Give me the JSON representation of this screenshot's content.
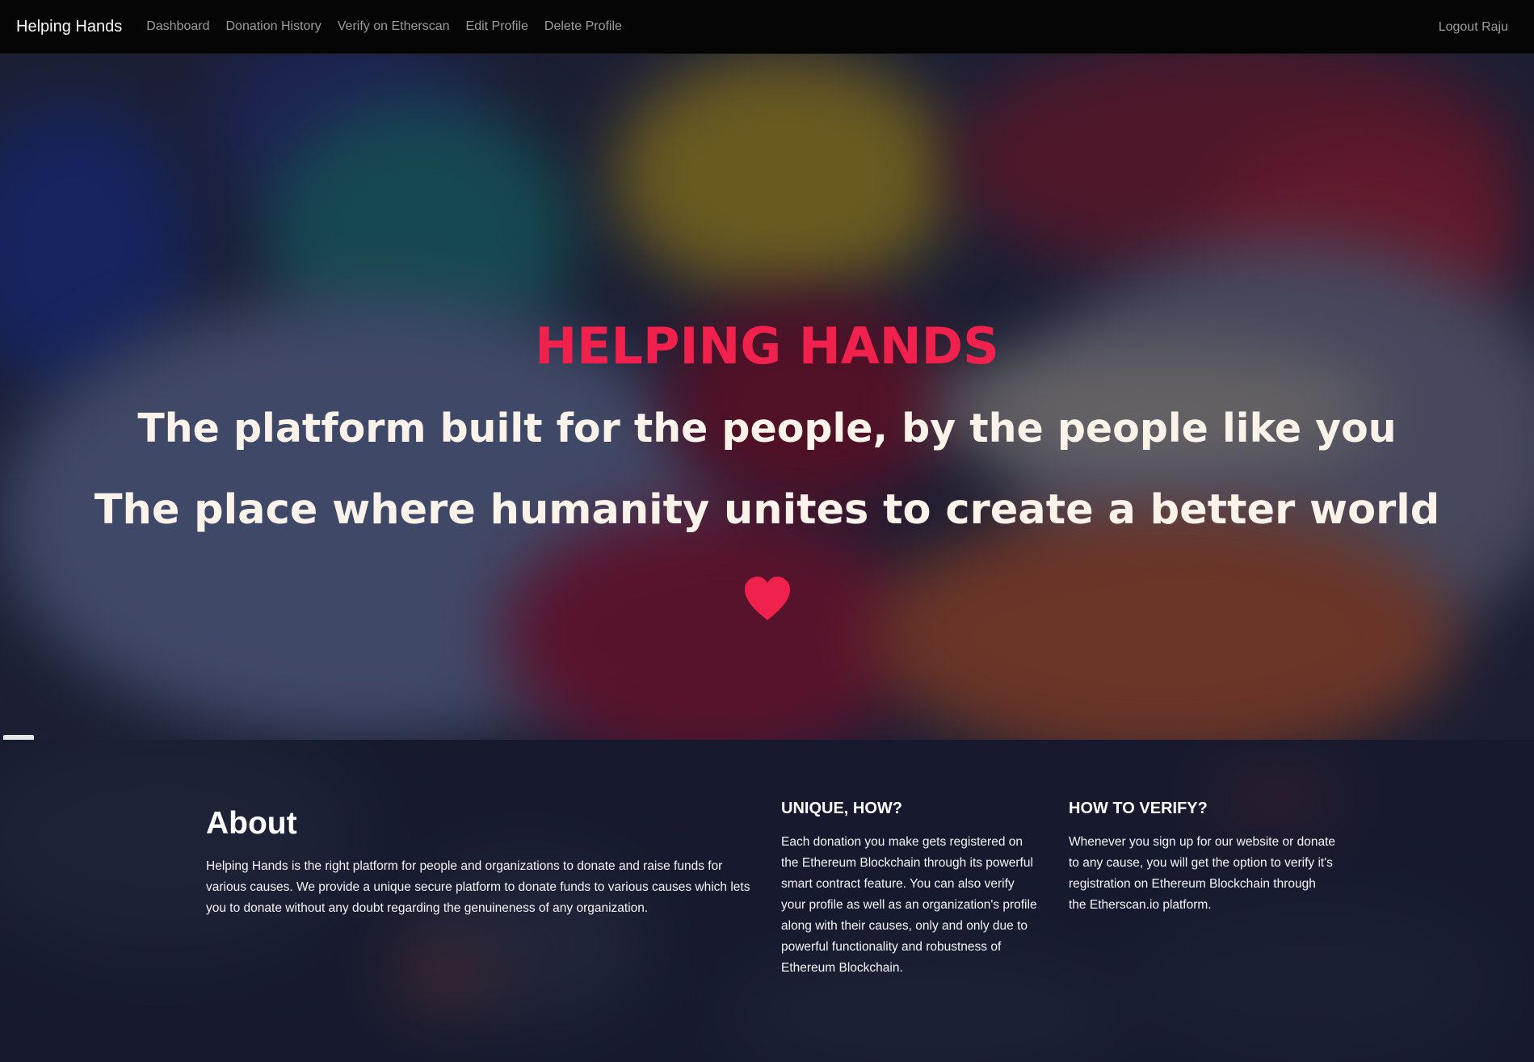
{
  "navbar": {
    "brand": "Helping Hands",
    "links": [
      "Dashboard",
      "Donation History",
      "Verify on Etherscan",
      "Edit Profile",
      "Delete Profile"
    ],
    "logout": "Logout Raju"
  },
  "hero": {
    "title": "HELPING HANDS",
    "line1": "The platform built for the people, by the people like you",
    "line2": "The place where humanity unites to create a better world",
    "icon": "heart-icon",
    "accent_color": "#f0214c"
  },
  "about": {
    "title": "About",
    "text": "Helping Hands is the right platform for people and organizations to donate and raise funds for various causes. We provide a unique secure platform to donate funds to various causes which lets you to donate without any doubt regarding the genuineness of any organization."
  },
  "unique": {
    "heading": "UNIQUE, HOW?",
    "text": "Each donation you make gets registered on the Ethereum Blockchain through its powerful smart contract feature. You can also verify your profile as well as an organization's profile along with their causes, only and only due to powerful functionality and robustness of Ethereum Blockchain."
  },
  "verify": {
    "heading": "HOW TO VERIFY?",
    "text": "Whenever you sign up for our website or donate to any cause, you will get the option to verify it's registration on Ethereum Blockchain through the Etherscan.io platform."
  }
}
